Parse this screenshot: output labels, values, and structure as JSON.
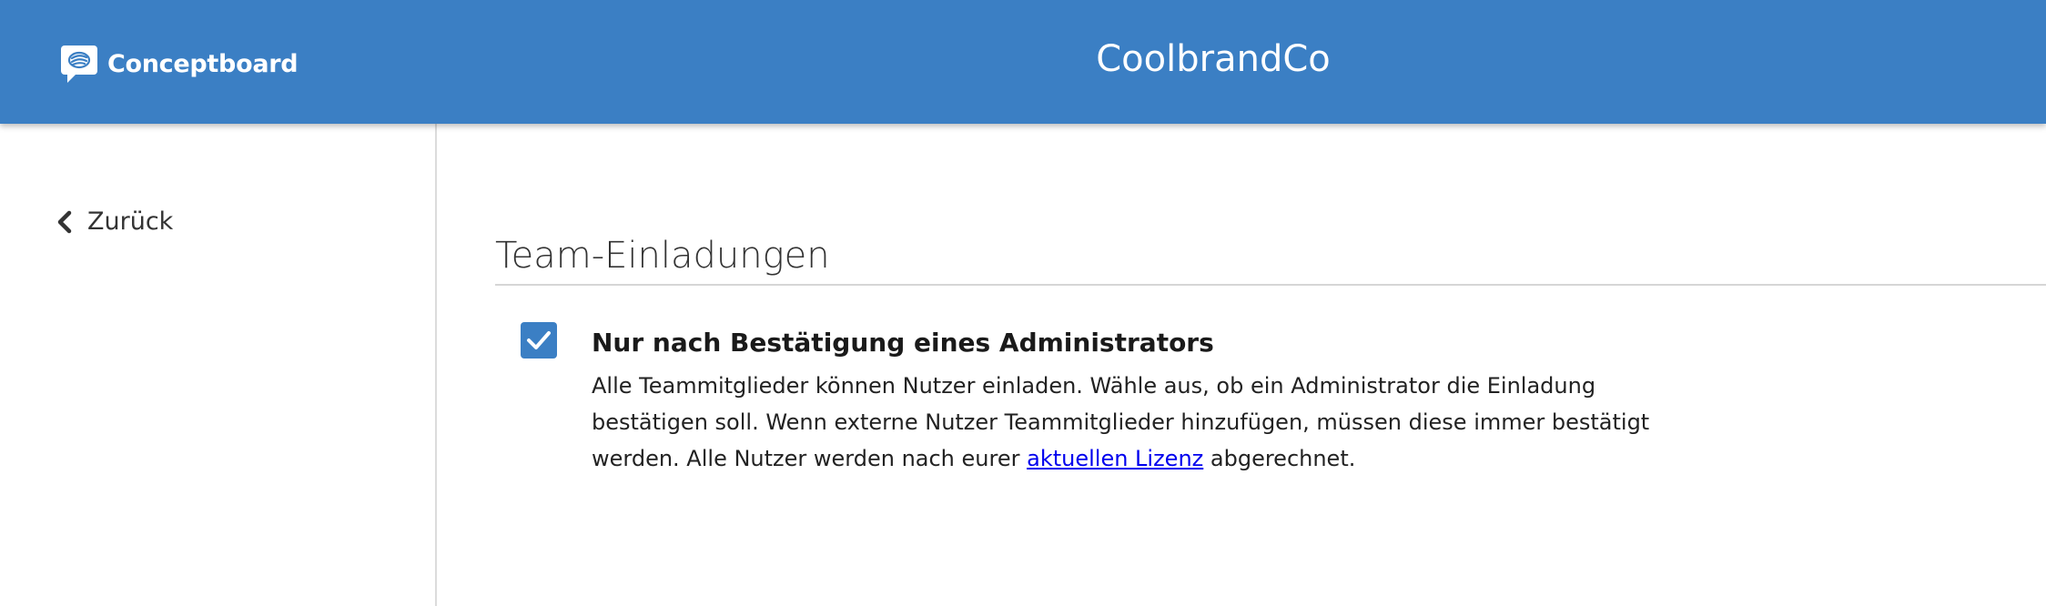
{
  "header": {
    "logo_text": "Conceptboard",
    "brand_title": "CoolbrandCo",
    "icons": {
      "logo": "conceptboard-logo-icon"
    },
    "colors": {
      "background": "#3b7fc4",
      "text": "#ffffff"
    }
  },
  "sidebar": {
    "back_label": "Zurück",
    "back_icon": "chevron-left-icon"
  },
  "main": {
    "section_title": "Team-Einladungen",
    "option": {
      "checked": true,
      "check_icon": "checkmark-icon",
      "title": "Nur nach Bestätigung eines Administrators",
      "description_before_link": "Alle Teammitglieder können Nutzer einladen. Wähle aus, ob ein Administrator die Einladung bestätigen soll. Wenn externe Nutzer Teammitglieder hinzufügen, müssen diese immer bestätigt werden. Alle Nutzer werden nach eurer ",
      "link_text": "aktuellen Lizenz",
      "description_after_link": " abgerechnet."
    },
    "colors": {
      "accent": "#3b7fc4",
      "link": "#0000ee"
    }
  }
}
